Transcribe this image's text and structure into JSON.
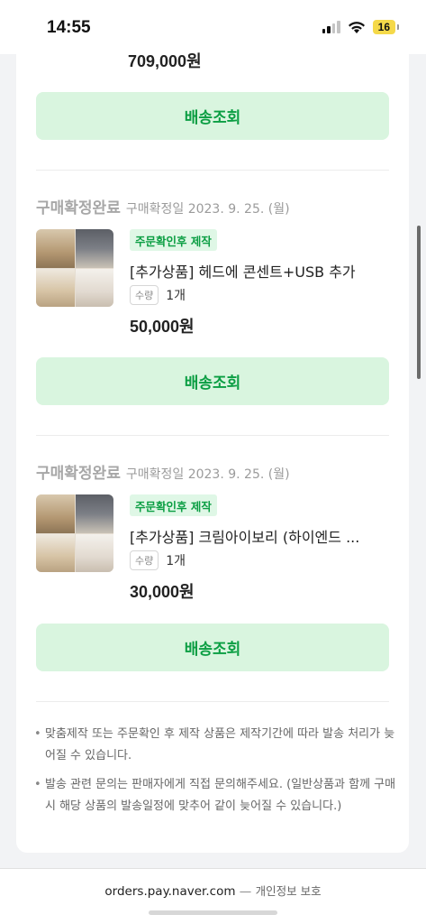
{
  "status_bar": {
    "time": "14:55",
    "battery": "16"
  },
  "top_item": {
    "price": "709,000원",
    "ship_label": "배송조회"
  },
  "orders": [
    {
      "status": "구매확정완료",
      "date": "구매확정일 2023. 9. 25. (월)",
      "tag": "주문확인후 제작",
      "name": "[추가상품] 헤드에 콘센트+USB 추가",
      "qty_label": "수량",
      "qty": "1개",
      "price": "50,000원",
      "ship_label": "배송조회"
    },
    {
      "status": "구매확정완료",
      "date": "구매확정일 2023. 9. 25. (월)",
      "tag": "주문확인후 제작",
      "name": "[추가상품] 크림아이보리 (하이엔드 ...",
      "qty_label": "수량",
      "qty": "1개",
      "price": "30,000원",
      "ship_label": "배송조회"
    }
  ],
  "notices": [
    "맞춤제작 또는 주문확인 후 제작 상품은 제작기간에 따라 발송 처리가 늦어질 수 있습니다.",
    "발송 관련 문의는 판매자에게 직접 문의해주세요. (일반상품과 함께 구매 시 해당 상품의 발송일정에 맞추어 같이 늦어질 수 있습니다.)"
  ],
  "footer": {
    "domain": "orders.pay.naver.com",
    "separator": "—",
    "privacy": "개인정보 보호"
  },
  "colors": {
    "accent_green": "#0b9e43",
    "button_bg": "#d9f5df",
    "battery": "#f5d94a"
  }
}
